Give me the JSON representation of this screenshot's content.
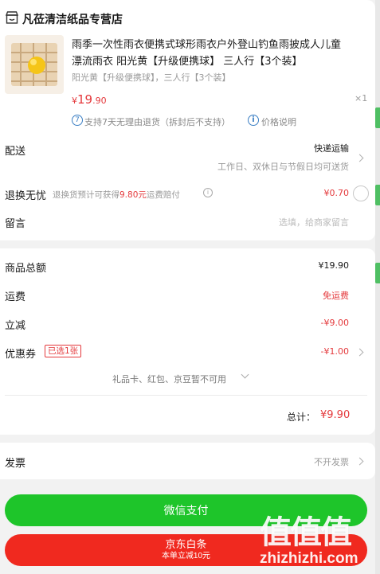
{
  "colors": {
    "price_red": "#e4393c",
    "muted_gray": "#999999",
    "wechat_green": "#1ec52a",
    "jd_red": "#f0291f",
    "info_blue": "#3b7fc4"
  },
  "shop": {
    "icon": "shop-icon",
    "name": "凡莅清洁纸品专营店"
  },
  "product": {
    "title_line1": "雨季一次性雨衣便携式球形雨衣户外登山钓鱼雨披成人儿童",
    "title_line2": "漂流雨衣 阳光黄【升级便携球】 三人行【3个装】",
    "spec": "阳光黄【升级便携球】，三人行【3个装】",
    "price_symbol": "¥",
    "price_int": "19",
    "price_dec": ".90",
    "quantity": "×1",
    "return_policy_num": "7",
    "return_policy": "支持7天无理由退货（拆封后不支持）",
    "price_note": "价格说明"
  },
  "delivery": {
    "label": "配送",
    "method": "快递运输",
    "schedule": "工作日、双休日与节假日均可送货"
  },
  "return_insurance": {
    "label": "退换无忧",
    "desc_prefix": "退换货预计可获得",
    "desc_amount": "9.80元",
    "desc_suffix": "运费赔付",
    "price": "¥0.70"
  },
  "message": {
    "label": "留言",
    "placeholder": "选填，给商家留言"
  },
  "summary": {
    "goods_total_label": "商品总额",
    "goods_total": "¥19.90",
    "shipping_label": "运费",
    "shipping": "免运费",
    "discount_label": "立减",
    "discount": "-¥9.00",
    "coupon_label": "优惠券",
    "coupon_badge": "已选1张",
    "coupon": "-¥1.00",
    "unavailable_note": "礼品卡、红包、京豆暂不可用",
    "total_label": "总计：",
    "total": "¥9.90"
  },
  "invoice": {
    "label": "发票",
    "value": "不开发票"
  },
  "pay": {
    "wechat_label": "微信支付",
    "jd_label": "京东白条",
    "jd_sub": "本单立减10元"
  },
  "watermark": {
    "text": "值值值",
    "url": "zhizhizhi.com"
  }
}
